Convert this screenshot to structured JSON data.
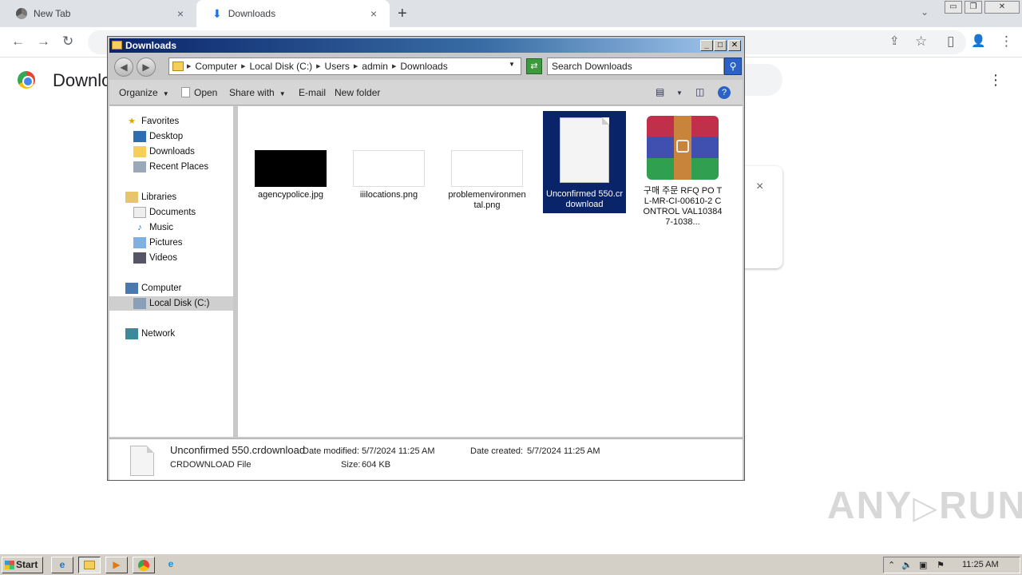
{
  "browser": {
    "tabs": [
      {
        "title": "New Tab",
        "close": "×"
      },
      {
        "title": "Downloads",
        "close": "×"
      }
    ],
    "new_tab": "+",
    "tabs_dropdown": "⌄",
    "window_controls": {
      "minimize": "▭",
      "restore": "❐",
      "close": "✕"
    },
    "toolbar": {
      "back": "←",
      "forward": "→",
      "reload": "↻",
      "share": "⇪",
      "bookmark": "☆",
      "side_panel": "▯",
      "profile": "👤",
      "menu": "⋮"
    }
  },
  "page": {
    "title": "Downloads",
    "menu": "⋮",
    "card_close": "×",
    "watermark": "ANY ▷ RUN"
  },
  "explorer": {
    "title": "Downloads",
    "controls": {
      "minimize": "_",
      "maximize": "□",
      "close": "✕"
    },
    "nav_back": "◀",
    "nav_forward": "▶",
    "breadcrumb": [
      "Computer",
      "Local Disk (C:)",
      "Users",
      "admin",
      "Downloads"
    ],
    "search_placeholder": "Search Downloads",
    "commands": {
      "organize": "Organize",
      "open": "Open",
      "share_with": "Share with",
      "email": "E-mail",
      "new_folder": "New folder"
    },
    "nav": {
      "favorites": "Favorites",
      "desktop": "Desktop",
      "downloads": "Downloads",
      "recent_places": "Recent Places",
      "libraries": "Libraries",
      "documents": "Documents",
      "music": "Music",
      "pictures": "Pictures",
      "videos": "Videos",
      "computer": "Computer",
      "local_disk": "Local Disk (C:)",
      "network": "Network"
    },
    "files": [
      {
        "name": "agencypolice.jpg"
      },
      {
        "name": "iiilocations.png"
      },
      {
        "name": "problemenvironmental.png"
      },
      {
        "name": "Unconfirmed 550.crdownload"
      },
      {
        "name": "구매 주문 RFQ PO TL-MR-CI-00610-2 CONTROL VAL103847-1038..."
      }
    ],
    "details": {
      "name": "Unconfirmed 550.crdownload",
      "type": "CRDOWNLOAD File",
      "date_modified_label": "Date modified:",
      "date_modified": "5/7/2024 11:25 AM",
      "date_created_label": "Date created:",
      "date_created": "5/7/2024 11:25 AM",
      "size_label": "Size:",
      "size": "604 KB"
    }
  },
  "taskbar": {
    "start": "Start",
    "clock": "11:25 AM"
  },
  "colors": {
    "selection": "#0a246a",
    "titlebar": "#0a246a",
    "chrome_tabstrip": "#dee1e6"
  }
}
